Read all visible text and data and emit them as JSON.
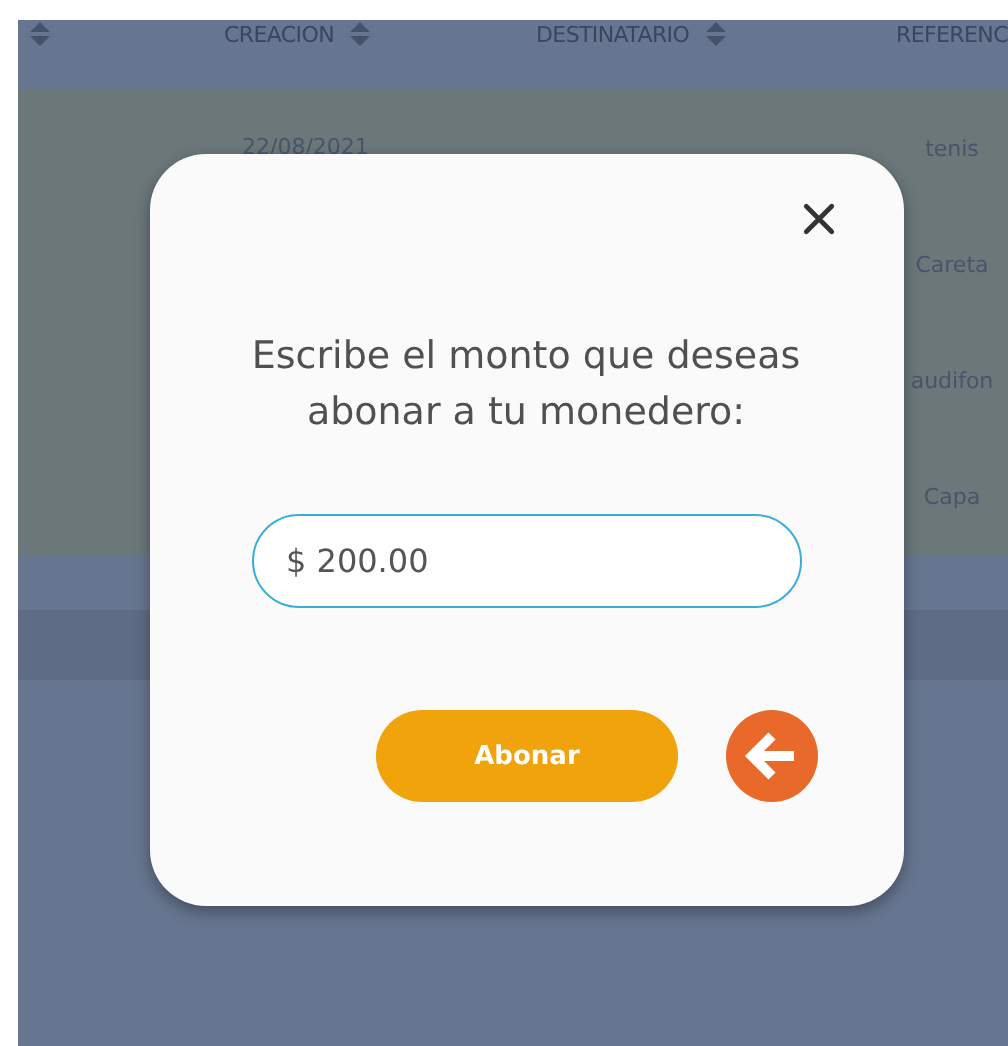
{
  "table": {
    "columns": [
      {
        "kind": "sort"
      },
      {
        "label": "CREACION",
        "kind": "sortable"
      },
      {
        "label": "DESTINATARIO",
        "kind": "sortable"
      },
      {
        "label": "REFERENC",
        "kind": "text"
      }
    ],
    "rows": [
      {
        "creacion": "22/08/2021",
        "referencia": "tenis"
      },
      {
        "referencia": "Careta"
      },
      {
        "referencia": "audifon"
      },
      {
        "referencia": "Capa"
      }
    ]
  },
  "dialog": {
    "message": "Escribe el monto que deseas abonar a tu monedero:",
    "amount": "$ 200.00",
    "button": "Abonar"
  }
}
